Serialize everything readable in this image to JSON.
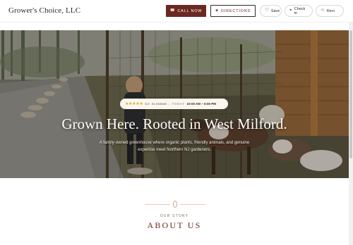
{
  "header": {
    "brand": "Grower's Choice, LLC",
    "call_label": "CALL NOW",
    "directions_label": "DIRECTIONS",
    "save_label": "Save",
    "checkin_label": "Check in",
    "review_label": "Revi"
  },
  "hero": {
    "rating_stars": "★★★★★",
    "rating_value": "5.0",
    "rating_count": "41 reviews",
    "today_label": "TODAY",
    "hours": "10:00 AM – 5:00 PM",
    "title": "Grown Here. Rooted in West Milford.",
    "subtitle": "A family-owned greenhouse where organic plants, friendly animals, and genuine expertise meet Northern NJ gardeners."
  },
  "about": {
    "eyebrow": "OUR STORY",
    "title": "ABOUT US"
  },
  "icons": {
    "call": "phone-icon",
    "directions": "navigation-icon",
    "save": "heart-icon",
    "checkin": "pin-icon",
    "review": "star-icon"
  },
  "colors": {
    "accent": "#6b2820",
    "star": "#e8a520",
    "divider": "#e3c9b3"
  }
}
